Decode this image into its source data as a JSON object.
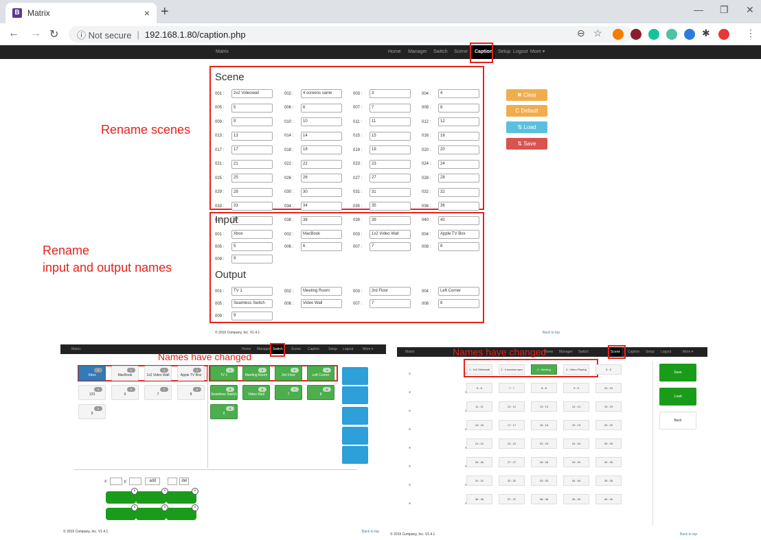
{
  "browser": {
    "tab_title": "Matrix",
    "tab_close": "×",
    "new_tab": "+",
    "not_secure": "ⓘ Not secure",
    "url": "192.168.1.80/caption.php",
    "window_minimize": "—",
    "window_restore": "❐",
    "window_close": "✕"
  },
  "navbar": {
    "brand": "Matrix",
    "items": [
      "Home",
      "Manager",
      "Switch",
      "Scene",
      "Caption",
      "Setup",
      "Logout",
      "More ▾"
    ],
    "active": "Caption"
  },
  "scene_panel": {
    "title": "Scene",
    "fields": [
      {
        "label": "001 :",
        "value": "2x2 Videowall"
      },
      {
        "label": "002 :",
        "value": "4 screens same"
      },
      {
        "label": "003 :",
        "value": "3"
      },
      {
        "label": "004 :",
        "value": "4"
      },
      {
        "label": "005 :",
        "value": "5"
      },
      {
        "label": "006 :",
        "value": "6"
      },
      {
        "label": "007 :",
        "value": "7"
      },
      {
        "label": "008 :",
        "value": "8"
      },
      {
        "label": "009 :",
        "value": "9"
      },
      {
        "label": "010 :",
        "value": "10"
      },
      {
        "label": "011 :",
        "value": "11"
      },
      {
        "label": "012 :",
        "value": "12"
      },
      {
        "label": "013 :",
        "value": "13"
      },
      {
        "label": "014 :",
        "value": "14"
      },
      {
        "label": "015 :",
        "value": "15"
      },
      {
        "label": "016 :",
        "value": "16"
      },
      {
        "label": "017 :",
        "value": "17"
      },
      {
        "label": "018 :",
        "value": "18"
      },
      {
        "label": "019 :",
        "value": "19"
      },
      {
        "label": "020 :",
        "value": "20"
      },
      {
        "label": "021 :",
        "value": "21"
      },
      {
        "label": "022 :",
        "value": "22"
      },
      {
        "label": "023 :",
        "value": "23"
      },
      {
        "label": "024 :",
        "value": "24"
      },
      {
        "label": "025 :",
        "value": "25"
      },
      {
        "label": "026 :",
        "value": "26"
      },
      {
        "label": "027 :",
        "value": "27"
      },
      {
        "label": "028 :",
        "value": "28"
      },
      {
        "label": "029 :",
        "value": "29"
      },
      {
        "label": "030 :",
        "value": "30"
      },
      {
        "label": "031 :",
        "value": "31"
      },
      {
        "label": "032 :",
        "value": "32"
      },
      {
        "label": "033 :",
        "value": "33"
      },
      {
        "label": "034 :",
        "value": "34"
      },
      {
        "label": "035 :",
        "value": "35"
      },
      {
        "label": "036 :",
        "value": "36"
      },
      {
        "label": "037 :",
        "value": "37"
      },
      {
        "label": "038 :",
        "value": "38"
      },
      {
        "label": "039 :",
        "value": "39"
      },
      {
        "label": "040 :",
        "value": "40"
      }
    ]
  },
  "input_panel": {
    "title": "Input",
    "fields": [
      {
        "label": "001 :",
        "value": "Xbox"
      },
      {
        "label": "002 :",
        "value": "MacBook"
      },
      {
        "label": "003 :",
        "value": "1x2 Video Wall"
      },
      {
        "label": "004 :",
        "value": "Apple TV Box"
      },
      {
        "label": "005 :",
        "value": "5"
      },
      {
        "label": "006 :",
        "value": "6"
      },
      {
        "label": "007 :",
        "value": "7"
      },
      {
        "label": "008 :",
        "value": "8"
      },
      {
        "label": "009 :",
        "value": "9"
      }
    ]
  },
  "output_panel": {
    "title": "Output",
    "fields": [
      {
        "label": "001 :",
        "value": "TV 1"
      },
      {
        "label": "002 :",
        "value": "Meeting Room"
      },
      {
        "label": "003 :",
        "value": "3rd Floor"
      },
      {
        "label": "004 :",
        "value": "Left Corner"
      },
      {
        "label": "005 :",
        "value": "Seamless Switch"
      },
      {
        "label": "006 :",
        "value": "Video Wall"
      },
      {
        "label": "007 :",
        "value": "7"
      },
      {
        "label": "008 :",
        "value": "8"
      },
      {
        "label": "009 :",
        "value": "9"
      }
    ]
  },
  "actions": {
    "clear": "✖ Clear",
    "default": "C Default",
    "load": "⇅ Load",
    "save": "⇅ Save",
    "clear_color": "#f0ad4e",
    "load_color": "#5bc0de",
    "save_color": "#d9534f"
  },
  "annotations": {
    "rename_scenes": "Rename scenes",
    "rename_io_line1": "Rename",
    "rename_io_line2": "input and output names",
    "names_changed_left": "Names have changed",
    "names_changed_right": "Names have changed"
  },
  "footer": {
    "copyright": "© 2019 Company, Inc. V1.4.1",
    "back_to_top": "Back to top"
  },
  "switch_view": {
    "navbar_active": "Switch",
    "inputs": [
      {
        "name": "Xbox",
        "badge": "1"
      },
      {
        "name": "MacBook",
        "badge": "2"
      },
      {
        "name": "1x2 Video Wall",
        "badge": "3"
      },
      {
        "name": "Apple TV Box",
        "badge": "4"
      },
      {
        "name": "123",
        "badge": "5"
      },
      {
        "name": "6",
        "badge": "6"
      },
      {
        "name": "7",
        "badge": "7"
      },
      {
        "name": "8",
        "badge": "8"
      },
      {
        "name": "9",
        "badge": "9"
      }
    ],
    "outputs": [
      {
        "name": "TV 1",
        "badge": "1"
      },
      {
        "name": "Meeting Room",
        "badge": "2"
      },
      {
        "name": "3rd Floor",
        "badge": "3"
      },
      {
        "name": "Left Corner",
        "badge": "4"
      },
      {
        "name": "Seamless Switch",
        "badge": "5"
      },
      {
        "name": "Video Wall",
        "badge": "6"
      },
      {
        "name": "7",
        "badge": "7"
      },
      {
        "name": "8",
        "badge": "8"
      },
      {
        "name": "9",
        "badge": "9"
      }
    ],
    "x_label": "x:",
    "y_label": "y:",
    "add_label": "add",
    "del_label": "del"
  },
  "scene_view": {
    "navbar_active": "Scene",
    "scenes": [
      "1 : 2x2 Videowall",
      "2 : 4 screens sam",
      "3 : Meeting",
      "4 : Video Playing",
      "5 : 5",
      "6 : 6",
      "7 : 7",
      "8 : 8",
      "9 : 9",
      "10 : 10",
      "11 : 11",
      "12 : 12",
      "13 : 13",
      "14 : 14",
      "15 : 15",
      "16 : 16",
      "17 : 17",
      "18 : 18",
      "19 : 19",
      "20 : 20",
      "21 : 21",
      "22 : 22",
      "23 : 23",
      "24 : 24",
      "25 : 25",
      "26 : 26",
      "27 : 27",
      "28 : 28",
      "29 : 29",
      "30 : 30",
      "31 : 31",
      "32 : 32",
      "33 : 33",
      "34 : 34",
      "35 : 35",
      "36 : 36",
      "37 : 37",
      "38 : 38",
      "39 : 39",
      "40 : 40"
    ],
    "active_scene_index": 2,
    "save": "Save",
    "load": "Load",
    "back": "Back"
  }
}
